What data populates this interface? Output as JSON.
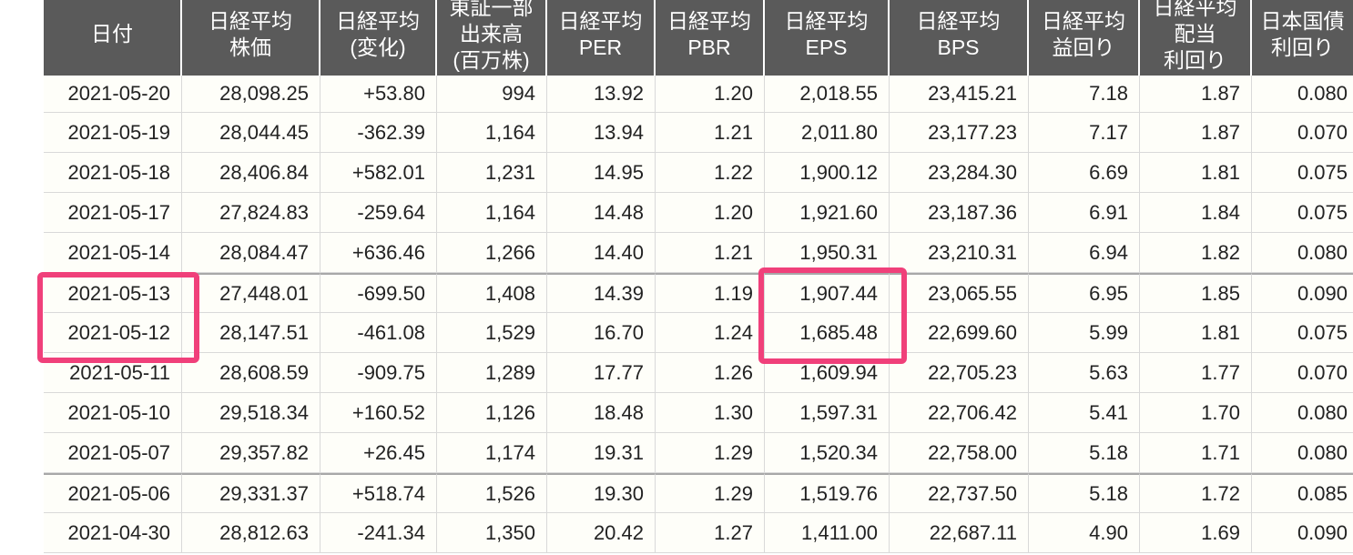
{
  "headers": [
    [
      "日付"
    ],
    [
      "日経平均",
      "株価"
    ],
    [
      "日経平均",
      "(変化)"
    ],
    [
      "東証一部",
      "出来高",
      "(百万株)"
    ],
    [
      "日経平均",
      "PER"
    ],
    [
      "日経平均",
      "PBR"
    ],
    [
      "日経平均",
      "EPS"
    ],
    [
      "日経平均",
      "BPS"
    ],
    [
      "日経平均",
      "益回り"
    ],
    [
      "日経平均",
      "配当",
      "利回り"
    ],
    [
      "日本国債",
      "利回り"
    ]
  ],
  "rows": [
    {
      "date": "2021-05-20",
      "price": "28,098.25",
      "change": "+53.80",
      "direction": "up",
      "volume": "994",
      "per": "13.92",
      "pbr": "1.20",
      "eps": "2,018.55",
      "bps": "23,415.21",
      "earnings_yield": "7.18",
      "dividend_yield": "1.87",
      "bond_yield": "0.080"
    },
    {
      "date": "2021-05-19",
      "price": "28,044.45",
      "change": "-362.39",
      "direction": "down",
      "volume": "1,164",
      "per": "13.94",
      "pbr": "1.21",
      "eps": "2,011.80",
      "bps": "23,177.23",
      "earnings_yield": "7.17",
      "dividend_yield": "1.87",
      "bond_yield": "0.070"
    },
    {
      "date": "2021-05-18",
      "price": "28,406.84",
      "change": "+582.01",
      "direction": "up",
      "volume": "1,231",
      "per": "14.95",
      "pbr": "1.22",
      "eps": "1,900.12",
      "bps": "23,284.30",
      "earnings_yield": "6.69",
      "dividend_yield": "1.81",
      "bond_yield": "0.075"
    },
    {
      "date": "2021-05-17",
      "price": "27,824.83",
      "change": "-259.64",
      "direction": "down",
      "volume": "1,164",
      "per": "14.48",
      "pbr": "1.20",
      "eps": "1,921.60",
      "bps": "23,187.36",
      "earnings_yield": "6.91",
      "dividend_yield": "1.84",
      "bond_yield": "0.075"
    },
    {
      "date": "2021-05-14",
      "price": "28,084.47",
      "change": "+636.46",
      "direction": "up",
      "volume": "1,266",
      "per": "14.40",
      "pbr": "1.21",
      "eps": "1,950.31",
      "bps": "23,210.31",
      "earnings_yield": "6.94",
      "dividend_yield": "1.82",
      "bond_yield": "0.080"
    },
    {
      "date": "2021-05-13",
      "price": "27,448.01",
      "change": "-699.50",
      "direction": "down",
      "volume": "1,408",
      "per": "14.39",
      "pbr": "1.19",
      "eps": "1,907.44",
      "bps": "23,065.55",
      "earnings_yield": "6.95",
      "dividend_yield": "1.85",
      "bond_yield": "0.090"
    },
    {
      "date": "2021-05-12",
      "price": "28,147.51",
      "change": "-461.08",
      "direction": "down",
      "volume": "1,529",
      "per": "16.70",
      "pbr": "1.24",
      "eps": "1,685.48",
      "bps": "22,699.60",
      "earnings_yield": "5.99",
      "dividend_yield": "1.81",
      "bond_yield": "0.075"
    },
    {
      "date": "2021-05-11",
      "price": "28,608.59",
      "change": "-909.75",
      "direction": "down",
      "volume": "1,289",
      "per": "17.77",
      "pbr": "1.26",
      "eps": "1,609.94",
      "bps": "22,705.23",
      "earnings_yield": "5.63",
      "dividend_yield": "1.77",
      "bond_yield": "0.070"
    },
    {
      "date": "2021-05-10",
      "price": "29,518.34",
      "change": "+160.52",
      "direction": "up",
      "volume": "1,126",
      "per": "18.48",
      "pbr": "1.30",
      "eps": "1,597.31",
      "bps": "22,706.42",
      "earnings_yield": "5.41",
      "dividend_yield": "1.70",
      "bond_yield": "0.080"
    },
    {
      "date": "2021-05-07",
      "price": "29,357.82",
      "change": "+26.45",
      "direction": "up",
      "volume": "1,174",
      "per": "19.31",
      "pbr": "1.29",
      "eps": "1,520.34",
      "bps": "22,758.00",
      "earnings_yield": "5.18",
      "dividend_yield": "1.71",
      "bond_yield": "0.080"
    },
    {
      "date": "2021-05-06",
      "price": "29,331.37",
      "change": "+518.74",
      "direction": "up",
      "volume": "1,526",
      "per": "19.30",
      "pbr": "1.29",
      "eps": "1,519.76",
      "bps": "22,737.50",
      "earnings_yield": "5.18",
      "dividend_yield": "1.72",
      "bond_yield": "0.085"
    },
    {
      "date": "2021-04-30",
      "price": "28,812.63",
      "change": "-241.34",
      "direction": "down",
      "volume": "1,350",
      "per": "20.42",
      "pbr": "1.27",
      "eps": "1,411.00",
      "bps": "22,687.11",
      "earnings_yield": "4.90",
      "dividend_yield": "1.69",
      "bond_yield": "0.090"
    }
  ],
  "colors": {
    "header_bg": "#5a5a5a",
    "up": "#1b8a1b",
    "down": "#e2262b",
    "per_bg": "#d8ecd6",
    "pbr_bg": "#d8e8fb",
    "highlight_box": "#f0407a"
  }
}
